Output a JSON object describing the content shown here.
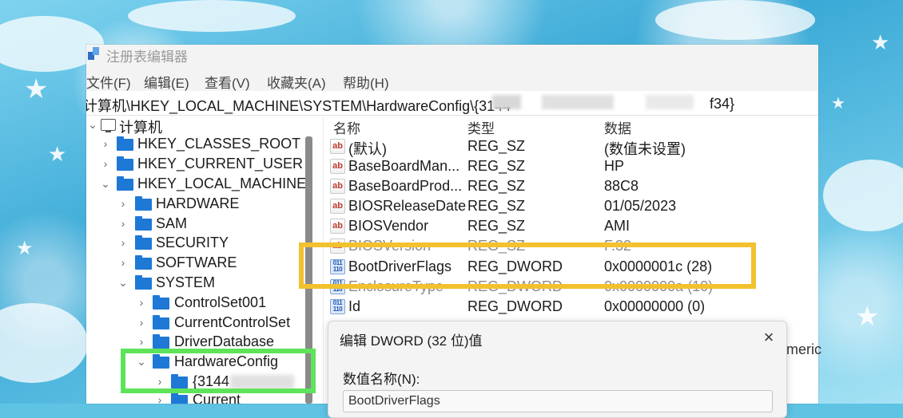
{
  "window": {
    "title": "注册表编辑器"
  },
  "menu": [
    "文件(F)",
    "编辑(E)",
    "查看(V)",
    "收藏夹(A)",
    "帮助(H)"
  ],
  "address": {
    "path": "计算机\\HKEY_LOCAL_MACHINE\\SYSTEM\\HardwareConfig\\{3144",
    "path_end": "f34}"
  },
  "tree": {
    "root": "计算机",
    "items": [
      {
        "label": "HKEY_CLASSES_ROOT",
        "expanded": false
      },
      {
        "label": "HKEY_CURRENT_USER",
        "expanded": false
      },
      {
        "label": "HKEY_LOCAL_MACHINE",
        "expanded": true
      },
      {
        "label": "HARDWARE",
        "expanded": false
      },
      {
        "label": "SAM",
        "expanded": false
      },
      {
        "label": "SECURITY",
        "expanded": false
      },
      {
        "label": "SOFTWARE",
        "expanded": false
      },
      {
        "label": "SYSTEM",
        "expanded": true
      },
      {
        "label": "ControlSet001",
        "expanded": false
      },
      {
        "label": "CurrentControlSet",
        "expanded": false
      },
      {
        "label": "DriverDatabase",
        "expanded": false
      },
      {
        "label": "HardwareConfig",
        "expanded": true
      },
      {
        "label": "{3144",
        "expanded": false
      },
      {
        "label": "Current",
        "expanded": false
      }
    ]
  },
  "values": {
    "headers": {
      "name": "名称",
      "type": "类型",
      "data": "数据"
    },
    "rows": [
      {
        "icon": "string-value-icon",
        "name": "(默认)",
        "type": "REG_SZ",
        "data": "(数值未设置)"
      },
      {
        "icon": "string-value-icon",
        "name": "BaseBoardMan...",
        "type": "REG_SZ",
        "data": "HP"
      },
      {
        "icon": "string-value-icon",
        "name": "BaseBoardProd...",
        "type": "REG_SZ",
        "data": "88C8"
      },
      {
        "icon": "string-value-icon",
        "name": "BIOSReleaseDate",
        "type": "REG_SZ",
        "data": "01/05/2023"
      },
      {
        "icon": "string-value-icon",
        "name": "BIOSVendor",
        "type": "REG_SZ",
        "data": "AMI"
      },
      {
        "icon": "string-value-icon",
        "name": "BIOSVersion",
        "type": "REG_SZ",
        "data": "F.32"
      },
      {
        "icon": "binary-value-icon",
        "name": "BootDriverFlags",
        "type": "REG_DWORD",
        "data": "0x0000001c (28)"
      },
      {
        "icon": "binary-value-icon",
        "name": "EnclosureType",
        "type": "REG_DWORD",
        "data": "0x0000000a (10)"
      },
      {
        "icon": "binary-value-icon",
        "name": "Id",
        "type": "REG_DWORD",
        "data": "0x00000000 (0)"
      }
    ]
  },
  "dialog": {
    "title": "编辑 DWORD (32 位)值",
    "close": "×",
    "name_label": "数值名称(N):",
    "name_value": "BootDriverFlags"
  },
  "side_text": "meric",
  "colors": {
    "highlight_yellow": "#f2c12e",
    "highlight_green": "#5fe35a",
    "folder": "#1e78d6"
  }
}
